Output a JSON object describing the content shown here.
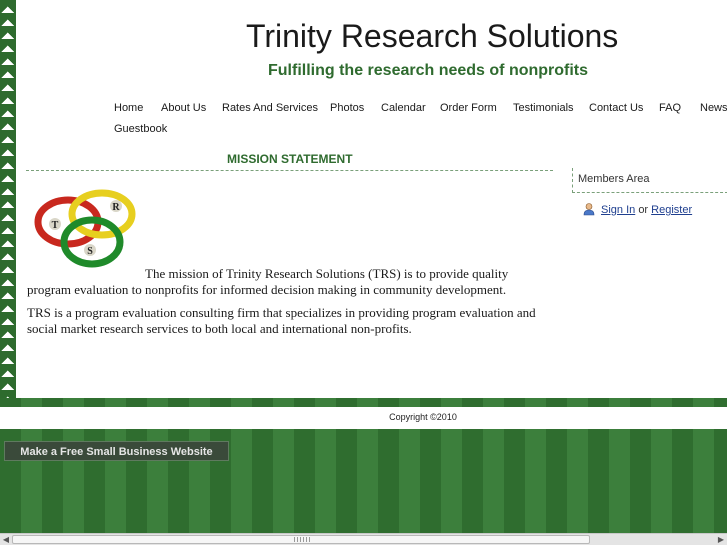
{
  "header": {
    "site_title": "Trinity Research Solutions",
    "tagline": "Fulfilling the research needs of nonprofits"
  },
  "nav": {
    "items": [
      "Home",
      "About Us",
      "Rates And Services",
      "Photos",
      "Calendar",
      "Order Form",
      "Testimonials",
      "Contact Us",
      "FAQ",
      "News",
      "Guestbook"
    ]
  },
  "main": {
    "section_title": "MISSION STATEMENT",
    "logo_letters": [
      "T",
      "R",
      "S"
    ],
    "paragraph1": "The mission of Trinity Research Solutions (TRS) is to provide quality program evaluation to nonprofits for informed decision making in community development.",
    "paragraph2": "TRS is a program evaluation consulting firm that specializes in providing program evaluation  and social market research services to both local and international non-profits."
  },
  "members": {
    "title": "Members Area",
    "sign_in": "Sign In",
    "or": "or",
    "register": "Register"
  },
  "footer": {
    "copyright": "Copyright ©2010",
    "make_site_button": "Make a Free Small Business Website"
  },
  "scrollbar": {
    "left_arrow": "◀",
    "right_arrow": "▶"
  },
  "colors": {
    "brand_green": "#2f6b2f",
    "link_blue": "#1f3f8f"
  }
}
